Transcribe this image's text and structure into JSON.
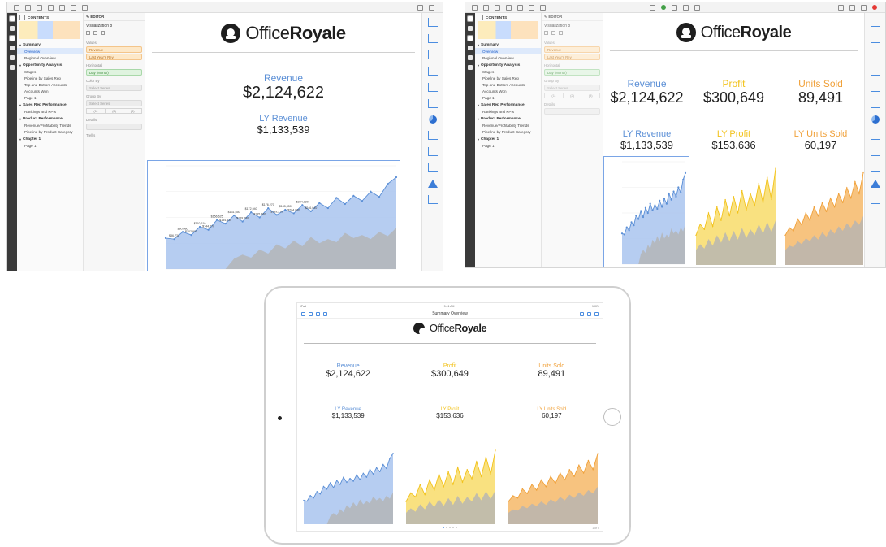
{
  "brand": {
    "name_light": "Office",
    "name_bold": "Royale"
  },
  "sidebar": {
    "header": "CONTENTS",
    "sections": [
      {
        "label": "Summary",
        "items": [
          "Overview",
          "Regional Overview"
        ]
      },
      {
        "label": "Opportunity Analysis",
        "items": [
          "Stages",
          "Pipeline by Sales Rep",
          "Top and Bottom Accounts",
          "Accounts Won",
          "Page 1"
        ]
      },
      {
        "label": "Sales Rep Performance",
        "items": [
          "Rankings and KPIs"
        ]
      },
      {
        "label": "Product Performance",
        "items": [
          "Revenue/Profitability Trends",
          "Pipeline by Product Category"
        ]
      },
      {
        "label": "Chapter 1",
        "items": [
          "Page 1"
        ]
      }
    ],
    "selected_item": "Overview"
  },
  "editor": {
    "header": "EDITOR",
    "title": "Visualization 8",
    "values_label": "Values",
    "value_pills": [
      "Revenue",
      "Last Year's Rev"
    ],
    "horizontal_label": "Horizontal",
    "horizontal_pill": "Day (Month)",
    "color_label": "Color By",
    "color_pill": "Select Series",
    "group_label": "Group By",
    "group_pill": "Select Series",
    "group_options": [
      "(1)",
      "(2)",
      "(3)"
    ],
    "details_label": "Details",
    "trellis_label": "Trellis"
  },
  "right_editor": {
    "values_label": "Values",
    "value_pills": [
      "Revenue",
      "Last Year's Rev"
    ],
    "horizontal_label": "Horizontal",
    "horizontal_pill": "Day (Month)",
    "group_label": "Group By",
    "group_pill": "Select Series",
    "group_options": [
      "(1)",
      "(2)",
      "(3)"
    ],
    "details_label": "Details"
  },
  "kpis": {
    "revenue": {
      "label": "Revenue",
      "value": "$2,124,622"
    },
    "ly_revenue": {
      "label": "LY Revenue",
      "value": "$1,133,539"
    },
    "profit": {
      "label": "Profit",
      "value": "$300,649"
    },
    "ly_profit": {
      "label": "LY Profit",
      "value": "$153,636"
    },
    "units": {
      "label": "Units Sold",
      "value": "89,491"
    },
    "ly_units": {
      "label": "LY Units Sold",
      "value": "60,197"
    }
  },
  "ipad": {
    "nav_title": "Summary Overview",
    "status_left": "iPad",
    "status_center": "9:41 AM",
    "status_right": "100%",
    "page_indicator": "1 of 5"
  },
  "colors": {
    "revenue": "#5b8fd6",
    "revenue_fill": "#a9c4ee",
    "profit": "#f2c21b",
    "profit_fill": "#f8dc6a",
    "units": "#f0a13a",
    "units_fill": "#f6b968",
    "ly_fill": "#b4b4b4"
  },
  "chart_data": [
    {
      "type": "area",
      "name": "revenue",
      "x": [
        1,
        2,
        3,
        4,
        5,
        6,
        7,
        8,
        9,
        10,
        11,
        12,
        13,
        14,
        15,
        16,
        17,
        18,
        19,
        20,
        21,
        22,
        23,
        24,
        25,
        26,
        27,
        28
      ],
      "series": [
        {
          "name": "Revenue",
          "values": [
            60,
            58,
            72,
            66,
            82,
            76,
            95,
            88,
            104,
            92,
            110,
            100,
            118,
            105,
            115,
            108,
            124,
            112,
            128,
            118,
            138,
            126,
            142,
            132,
            150,
            140,
            165,
            178
          ]
        },
        {
          "name": "LY Revenue",
          "values": [
            0,
            0,
            0,
            0,
            0,
            0,
            0,
            0,
            20,
            28,
            22,
            38,
            30,
            48,
            40,
            55,
            44,
            62,
            50,
            58,
            52,
            70,
            60,
            66,
            58,
            72,
            64,
            80
          ]
        }
      ],
      "data_labels": [
        "$86,730",
        "$80,080",
        "$102,900",
        "$110,610",
        "$144,270",
        "$156,625",
        "$184,310",
        "$131,650",
        "$159,690",
        "$172,940",
        "$195,380",
        "$176,270",
        "$189,270",
        "$185,350",
        "$204,860",
        "$224,920",
        "$246,040"
      ],
      "ylim": [
        0,
        200
      ]
    },
    {
      "type": "area",
      "name": "profit",
      "x": [
        1,
        2,
        3,
        4,
        5,
        6,
        7,
        8,
        9,
        10,
        11,
        12,
        13,
        14,
        15,
        16,
        17,
        18,
        19,
        20
      ],
      "series": [
        {
          "name": "Profit",
          "values": [
            40,
            55,
            48,
            70,
            52,
            78,
            60,
            88,
            66,
            92,
            70,
            100,
            74,
            96,
            80,
            110,
            84,
            118,
            88,
            130
          ]
        },
        {
          "name": "LY Profit",
          "values": [
            20,
            28,
            22,
            35,
            26,
            40,
            30,
            44,
            32,
            46,
            34,
            50,
            36,
            48,
            40,
            55,
            42,
            58,
            44,
            60
          ]
        }
      ],
      "ylim": [
        0,
        140
      ]
    },
    {
      "type": "area",
      "name": "units",
      "x": [
        1,
        2,
        3,
        4,
        5,
        6,
        7,
        8,
        9,
        10,
        11,
        12,
        13,
        14,
        15,
        16,
        17,
        18,
        19,
        20
      ],
      "series": [
        {
          "name": "Units Sold",
          "values": [
            40,
            50,
            46,
            62,
            54,
            70,
            60,
            78,
            66,
            84,
            72,
            90,
            78,
            96,
            84,
            104,
            90,
            112,
            96,
            124
          ]
        },
        {
          "name": "LY Units Sold",
          "values": [
            20,
            26,
            24,
            32,
            28,
            36,
            32,
            40,
            34,
            44,
            38,
            48,
            42,
            52,
            46,
            56,
            50,
            60,
            54,
            66
          ]
        }
      ],
      "ylim": [
        0,
        140
      ]
    }
  ]
}
